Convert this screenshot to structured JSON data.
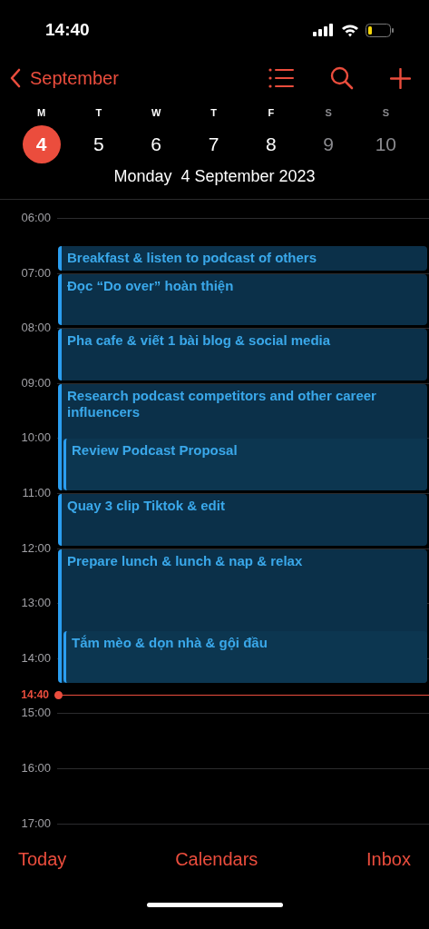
{
  "status_bar": {
    "time": "14:40"
  },
  "nav": {
    "back_label": "September"
  },
  "week": [
    {
      "letter": "M",
      "number": "4",
      "selected": true,
      "weekend": false
    },
    {
      "letter": "T",
      "number": "5",
      "selected": false,
      "weekend": false
    },
    {
      "letter": "W",
      "number": "6",
      "selected": false,
      "weekend": false
    },
    {
      "letter": "T",
      "number": "7",
      "selected": false,
      "weekend": false
    },
    {
      "letter": "F",
      "number": "8",
      "selected": false,
      "weekend": false
    },
    {
      "letter": "S",
      "number": "9",
      "selected": false,
      "weekend": true
    },
    {
      "letter": "S",
      "number": "10",
      "selected": false,
      "weekend": true
    }
  ],
  "date_title": {
    "weekday": "Monday",
    "date": "4 September 2023"
  },
  "hours": [
    "06:00",
    "07:00",
    "08:00",
    "09:00",
    "10:00",
    "11:00",
    "12:00",
    "13:00",
    "14:00",
    "15:00",
    "16:00",
    "17:00"
  ],
  "events": [
    {
      "title": "Breakfast & listen to podcast of others"
    },
    {
      "title": "Đọc “Do over” hoàn thiện"
    },
    {
      "title": "Pha cafe & viết 1 bài blog & social media"
    },
    {
      "title": "Research podcast competitors and other career influencers",
      "children": [
        {
          "title": "Review Podcast Proposal"
        }
      ]
    },
    {
      "title": "Quay 3 clip Tiktok & edit"
    },
    {
      "title": "Prepare lunch & lunch & nap & relax",
      "children": [
        {
          "title": "Tắm mèo & dọn nhà & gội đầu"
        }
      ]
    }
  ],
  "now": {
    "label": "14:40"
  },
  "tab_bar": [
    "Today",
    "Calendars",
    "Inbox"
  ]
}
